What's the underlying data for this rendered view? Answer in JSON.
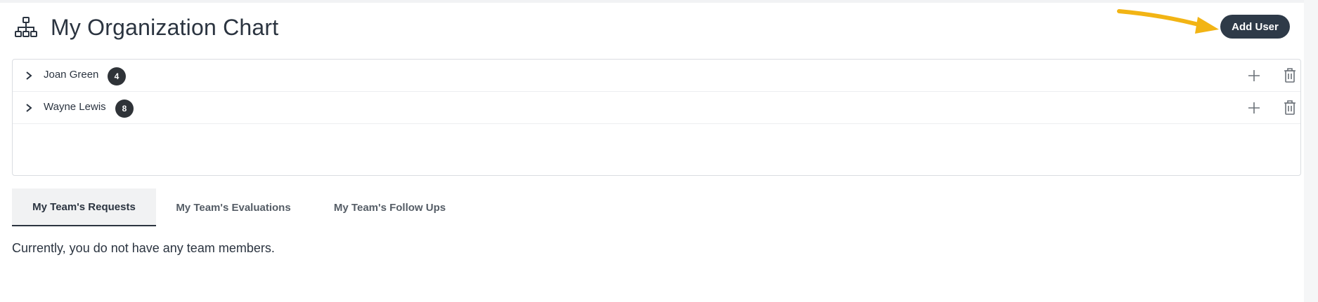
{
  "page": {
    "title": "My Organization Chart",
    "title_icon": "org-chart-icon"
  },
  "toolbar": {
    "add_user_label": "Add User",
    "pointer_arrow_color": "#f2b414"
  },
  "org_tree": {
    "rows": [
      {
        "name": "Joan Green",
        "count": "4",
        "expand_icon": "chevron-right-icon",
        "add_icon": "plus-icon",
        "delete_icon": "trash-icon"
      },
      {
        "name": "Wayne Lewis",
        "count": "8",
        "expand_icon": "chevron-right-icon",
        "add_icon": "plus-icon",
        "delete_icon": "trash-icon"
      }
    ]
  },
  "tabs": [
    {
      "label": "My Team's Requests",
      "active": true
    },
    {
      "label": "My Team's Evaluations",
      "active": false
    },
    {
      "label": "My Team's Follow Ups",
      "active": false
    }
  ],
  "tab_content": {
    "message": "Currently, you do not have any team members."
  },
  "colors": {
    "primary_dark": "#2e3a48",
    "badge": "#2f3338",
    "text": "#2b3440"
  }
}
